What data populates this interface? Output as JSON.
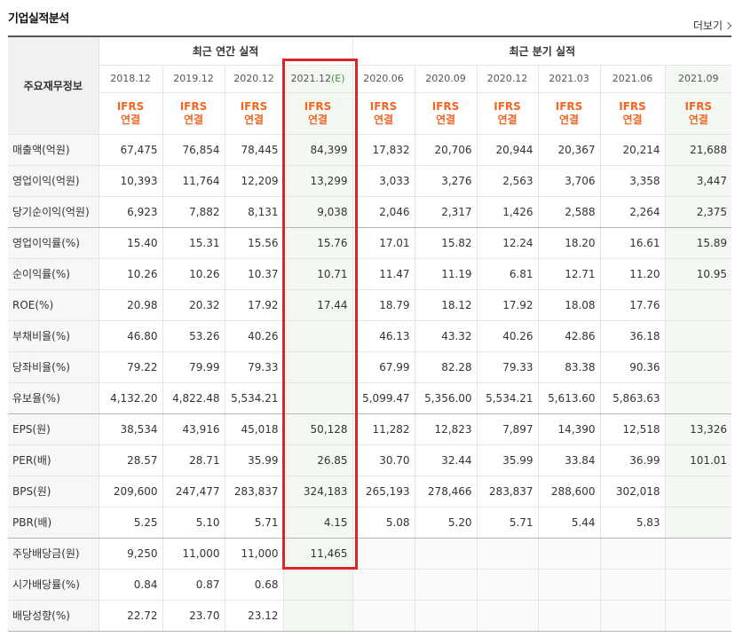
{
  "title": "기업실적분석",
  "more_label": "더보기",
  "corner_label": "주요재무정보",
  "groups": {
    "annual": "최근 연간 실적",
    "quarter": "최근 분기 실적"
  },
  "periods": [
    "2018.12",
    "2019.12",
    "2020.12",
    "2021.12",
    "2020.06",
    "2020.09",
    "2020.12",
    "2021.03",
    "2021.06",
    "2021.09"
  ],
  "estimate_mark": "(E)",
  "ifrs_top": "IFRS",
  "ifrs_bottom": "연결",
  "rows": [
    {
      "label": "매출액(억원)",
      "values": [
        "67,475",
        "76,854",
        "78,445",
        "84,399",
        "17,832",
        "20,706",
        "20,944",
        "20,367",
        "20,214",
        "21,688"
      ]
    },
    {
      "label": "영업이익(억원)",
      "values": [
        "10,393",
        "11,764",
        "12,209",
        "13,299",
        "3,033",
        "3,276",
        "2,563",
        "3,706",
        "3,358",
        "3,447"
      ]
    },
    {
      "label": "당기순이익(억원)",
      "values": [
        "6,923",
        "7,882",
        "8,131",
        "9,038",
        "2,046",
        "2,317",
        "1,426",
        "2,588",
        "2,264",
        "2,375"
      ]
    },
    {
      "label": "영업이익률(%)",
      "values": [
        "15.40",
        "15.31",
        "15.56",
        "15.76",
        "17.01",
        "15.82",
        "12.24",
        "18.20",
        "16.61",
        "15.89"
      ]
    },
    {
      "label": "순이익률(%)",
      "values": [
        "10.26",
        "10.26",
        "10.37",
        "10.71",
        "11.47",
        "11.19",
        "6.81",
        "12.71",
        "11.20",
        "10.95"
      ]
    },
    {
      "label": "ROE(%)",
      "values": [
        "20.98",
        "20.32",
        "17.92",
        "17.44",
        "18.79",
        "18.12",
        "17.92",
        "18.08",
        "17.76",
        ""
      ]
    },
    {
      "label": "부채비율(%)",
      "values": [
        "46.80",
        "53.26",
        "40.26",
        "",
        "46.13",
        "43.32",
        "40.26",
        "42.86",
        "36.18",
        ""
      ]
    },
    {
      "label": "당좌비율(%)",
      "values": [
        "79.22",
        "79.99",
        "79.33",
        "",
        "67.99",
        "82.28",
        "79.33",
        "83.38",
        "90.36",
        ""
      ]
    },
    {
      "label": "유보율(%)",
      "values": [
        "4,132.20",
        "4,822.48",
        "5,534.21",
        "",
        "5,099.47",
        "5,356.00",
        "5,534.21",
        "5,613.60",
        "5,863.63",
        ""
      ]
    },
    {
      "label": "EPS(원)",
      "values": [
        "38,534",
        "43,916",
        "45,018",
        "50,128",
        "11,282",
        "12,823",
        "7,897",
        "14,390",
        "12,518",
        "13,326"
      ]
    },
    {
      "label": "PER(배)",
      "values": [
        "28.57",
        "28.71",
        "35.99",
        "26.85",
        "30.70",
        "32.44",
        "35.99",
        "33.84",
        "36.99",
        "101.01"
      ]
    },
    {
      "label": "BPS(원)",
      "values": [
        "209,600",
        "247,477",
        "283,837",
        "324,183",
        "265,193",
        "278,466",
        "283,837",
        "288,600",
        "302,018",
        ""
      ]
    },
    {
      "label": "PBR(배)",
      "values": [
        "5.25",
        "5.10",
        "5.71",
        "4.15",
        "5.08",
        "5.20",
        "5.71",
        "5.44",
        "5.83",
        ""
      ]
    },
    {
      "label": "주당배당금(원)",
      "values": [
        "9,250",
        "11,000",
        "11,000",
        "11,465",
        "",
        "",
        "",
        "",
        "",
        ""
      ]
    },
    {
      "label": "시가배당률(%)",
      "values": [
        "0.84",
        "0.87",
        "0.68",
        "",
        "",
        "",
        "",
        "",
        "",
        ""
      ]
    },
    {
      "label": "배당성향(%)",
      "values": [
        "22.72",
        "23.70",
        "23.12",
        "",
        "",
        "",
        "",
        "",
        "",
        ""
      ]
    }
  ],
  "colors": {
    "ifrs": "#f26522",
    "estimate": "#3a9a3a",
    "highlight_box": "#d62626",
    "estimate_bg": "#f3f9f2"
  }
}
